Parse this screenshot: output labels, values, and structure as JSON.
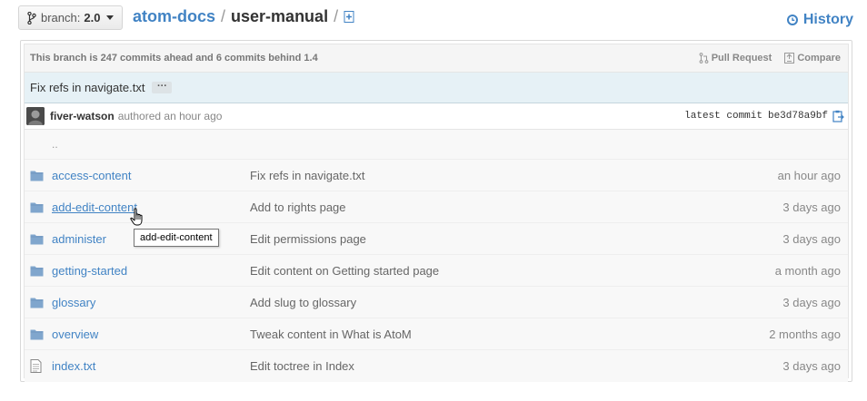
{
  "branch": {
    "label": "branch:",
    "value": "2.0"
  },
  "breadcrumb": {
    "repo": "atom-docs",
    "separator": "/",
    "current": "user-manual",
    "trailing_separator": "/"
  },
  "history": {
    "label": "History"
  },
  "status": {
    "prefix": "This branch is ",
    "ahead": "247 commits ahead",
    "middle": " and ",
    "behind": "6 commits behind",
    "base": " 1.4",
    "pull_request": "Pull Request",
    "compare": "Compare"
  },
  "commit": {
    "message": "Fix refs in navigate.txt",
    "ellipsis": "···"
  },
  "author": {
    "name": "fiver-watson",
    "authored": "authored an hour ago",
    "latest_label": "latest commit",
    "sha": "be3d78a9bf"
  },
  "up_dir": "..",
  "files": [
    {
      "type": "folder",
      "name": "access-content",
      "message": "Fix refs in navigate.txt",
      "age": "an hour ago"
    },
    {
      "type": "folder",
      "name": "add-edit-content",
      "message": "Add to rights page",
      "age": "3 days ago"
    },
    {
      "type": "folder",
      "name": "administer",
      "message": "Edit permissions page",
      "age": "3 days ago"
    },
    {
      "type": "folder",
      "name": "getting-started",
      "message": "Edit content on Getting started page",
      "age": "a month ago"
    },
    {
      "type": "folder",
      "name": "glossary",
      "message": "Add slug to glossary",
      "age": "3 days ago"
    },
    {
      "type": "folder",
      "name": "overview",
      "message": "Tweak content in What is AtoM",
      "age": "2 months ago"
    },
    {
      "type": "file",
      "name": "index.txt",
      "message": "Edit toctree in Index",
      "age": "3 days ago"
    }
  ],
  "tooltip": {
    "text": "add-edit-content"
  },
  "colors": {
    "link": "#4183c4",
    "commit_bg": "#e6f1f6",
    "folder": "#80a6cd"
  }
}
